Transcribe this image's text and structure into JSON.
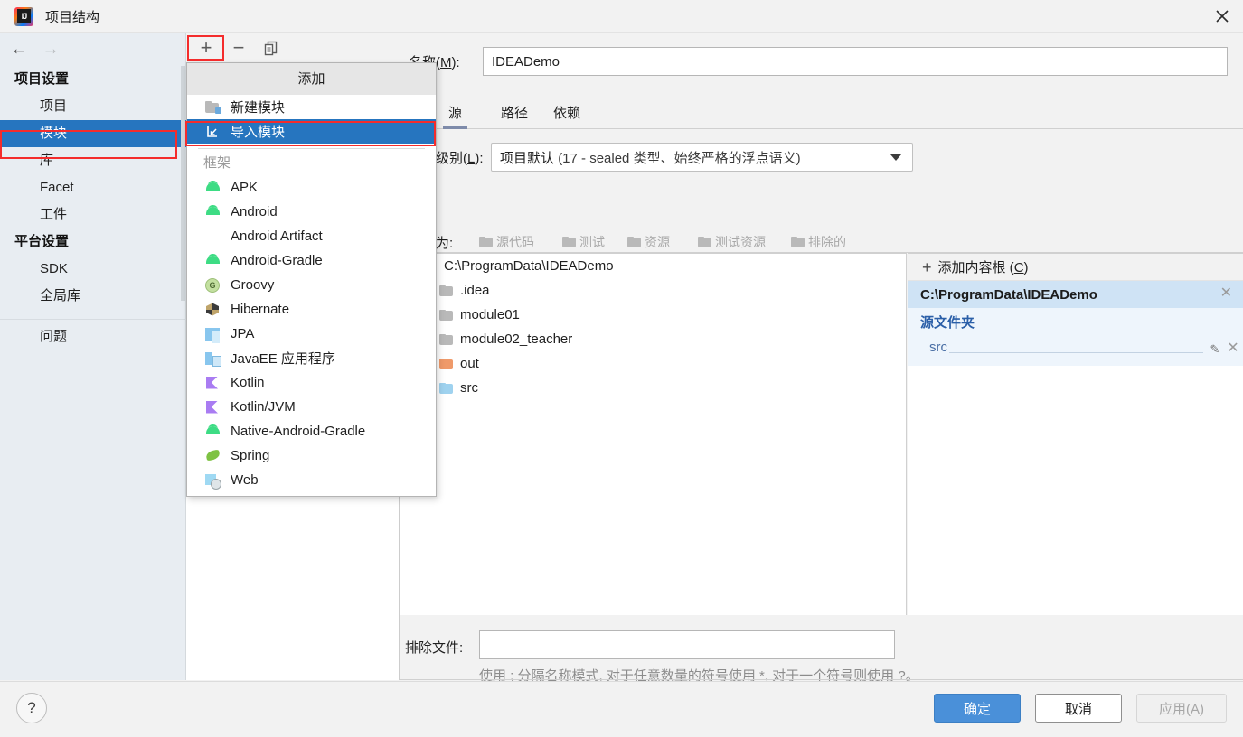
{
  "window": {
    "title": "项目结构",
    "logo_text": "IJ",
    "close_icon": "close-icon"
  },
  "sidebar": {
    "nav": {
      "back": "←",
      "forward": "→"
    },
    "sections": [
      {
        "header": "项目设置",
        "items": [
          {
            "label": "项目",
            "selected": false
          },
          {
            "label": "模块",
            "selected": true
          },
          {
            "label": "库",
            "selected": false
          },
          {
            "label": "Facet",
            "selected": false
          },
          {
            "label": "工件",
            "selected": false
          }
        ]
      },
      {
        "header": "平台设置",
        "items": [
          {
            "label": "SDK",
            "selected": false
          },
          {
            "label": "全局库",
            "selected": false
          }
        ]
      }
    ],
    "problems": "问题"
  },
  "module_toolbar": {
    "add": "+",
    "remove": "−",
    "copy_icon": "copy-icon"
  },
  "add_menu": {
    "title": "添加",
    "items": [
      {
        "label": "新建模块",
        "icon": "new-module-icon",
        "selected": false
      },
      {
        "label": "导入模块",
        "icon": "import-module-icon",
        "selected": true
      }
    ],
    "group_label": "框架",
    "frameworks": [
      {
        "label": "APK",
        "icon": "android-icon"
      },
      {
        "label": "Android",
        "icon": "android-icon"
      },
      {
        "label": "Android Artifact",
        "icon": "none"
      },
      {
        "label": "Android-Gradle",
        "icon": "android-icon"
      },
      {
        "label": "Groovy",
        "icon": "groovy-icon"
      },
      {
        "label": "Hibernate",
        "icon": "hibernate-icon"
      },
      {
        "label": "JPA",
        "icon": "jpa-icon"
      },
      {
        "label": "JavaEE 应用程序",
        "icon": "javaee-icon"
      },
      {
        "label": "Kotlin",
        "icon": "kotlin-icon"
      },
      {
        "label": "Kotlin/JVM",
        "icon": "kotlin-icon"
      },
      {
        "label": "Native-Android-Gradle",
        "icon": "android-icon"
      },
      {
        "label": "Spring",
        "icon": "spring-icon"
      },
      {
        "label": "Web",
        "icon": "web-icon"
      }
    ]
  },
  "detail": {
    "name_label_pre": "名称(",
    "name_label_mnemonic": "M",
    "name_label_post": "):",
    "name_value": "IDEADemo",
    "tabs": [
      {
        "label": "源",
        "active": true
      },
      {
        "label": "路径",
        "active": false
      },
      {
        "label": "依赖",
        "active": false
      }
    ],
    "level_label_pre": "语言级别(",
    "level_label_mnemonic": "L",
    "level_label_post": "):",
    "level_value_main": "项目默认",
    "level_value_detail": "(17 - sealed 类型、始终严格的浮点语义)",
    "mark_as_label": "标记为:",
    "mark_buttons": [
      {
        "label": "源代码",
        "icon": "folder-source-icon"
      },
      {
        "label": "测试",
        "icon": "folder-test-icon"
      },
      {
        "label": "资源",
        "icon": "folder-resource-icon"
      },
      {
        "label": "测试资源",
        "icon": "folder-test-resource-icon"
      },
      {
        "label": "排除的",
        "icon": "folder-excluded-icon"
      }
    ],
    "tree": [
      {
        "label": "C:\\ProgramData\\IDEADemo",
        "indent": 0,
        "expandable": false,
        "color": "dark"
      },
      {
        "label": ".idea",
        "indent": 1,
        "expandable": false,
        "color": "gray"
      },
      {
        "label": "module01",
        "indent": 1,
        "expandable": true,
        "color": "gray"
      },
      {
        "label": "module02_teacher",
        "indent": 1,
        "expandable": true,
        "color": "gray"
      },
      {
        "label": "out",
        "indent": 1,
        "expandable": true,
        "color": "orange"
      },
      {
        "label": "src",
        "indent": 1,
        "expandable": true,
        "color": "blue"
      }
    ],
    "exclude_label": "排除文件:",
    "exclude_value": "",
    "exclude_hint": "使用 ; 分隔名称模式, 对于任意数量的符号使用 *, 对于一个符号则使用 ?。"
  },
  "content_root_panel": {
    "add_label_pre": "添加内容根 (",
    "add_label_mnemonic": "C",
    "add_label_post": ")",
    "root_path": "C:\\ProgramData\\IDEADemo",
    "section_title": "源文件夹",
    "entries": [
      {
        "name": "src",
        "edit_icon": "pencil-icon",
        "remove_icon": "close-icon"
      }
    ],
    "close_icon": "close-icon"
  },
  "bottom": {
    "help": "?",
    "ok": "确定",
    "cancel": "取消",
    "apply": "应用(A)"
  },
  "highlights": {
    "accent_blue": "#2675bf",
    "red_outline": "#f42c2c",
    "ok_button_blue": "#4a90d9"
  }
}
